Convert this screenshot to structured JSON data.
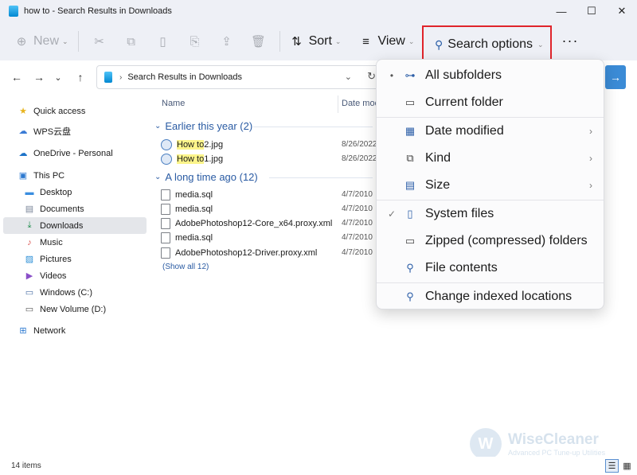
{
  "window": {
    "title": "how to - Search Results in Downloads",
    "controls": [
      "—",
      "☐",
      "✕"
    ]
  },
  "toolbar": {
    "new_label": "New",
    "sort_label": "Sort",
    "view_label": "View",
    "search_options_label": "Search options",
    "more_label": "···"
  },
  "address": {
    "crumb": "Search Results in Downloads"
  },
  "sidebar": {
    "items": [
      {
        "label": "Quick access",
        "icon": "star-icon"
      },
      {
        "label": "WPS云盘",
        "icon": "cloud-icon"
      },
      {
        "label": "OneDrive - Personal",
        "icon": "onedrive-icon"
      },
      {
        "label": "This PC",
        "icon": "computer-icon"
      },
      {
        "label": "Desktop",
        "icon": "desktop-icon"
      },
      {
        "label": "Documents",
        "icon": "documents-icon"
      },
      {
        "label": "Downloads",
        "icon": "download-icon"
      },
      {
        "label": "Music",
        "icon": "music-icon"
      },
      {
        "label": "Pictures",
        "icon": "pictures-icon"
      },
      {
        "label": "Videos",
        "icon": "videos-icon"
      },
      {
        "label": "Windows (C:)",
        "icon": "drive-icon"
      },
      {
        "label": "New Volume (D:)",
        "icon": "drive-icon"
      },
      {
        "label": "Network",
        "icon": "network-icon"
      }
    ]
  },
  "columns": {
    "name": "Name",
    "date": "Date mod"
  },
  "groups": [
    {
      "header": "Earlier this year (2)",
      "files": [
        {
          "hl": "How to",
          "rest": " 2.jpg",
          "date": "8/26/2022"
        },
        {
          "hl": "How to",
          "rest": " 1.jpg",
          "date": "8/26/2022"
        }
      ]
    },
    {
      "header": "A long time ago (12)",
      "files": [
        {
          "name": "media.sql",
          "date": "4/7/2010"
        },
        {
          "name": "media.sql",
          "date": "4/7/2010"
        },
        {
          "name": "AdobePhotoshop12-Core_x64.proxy.xml",
          "date": "4/7/2010"
        },
        {
          "name": "media.sql",
          "date": "4/7/2010"
        },
        {
          "name": "AdobePhotoshop12-Driver.proxy.xml",
          "date": "4/7/2010"
        }
      ]
    }
  ],
  "show_all": "(Show all 12)",
  "status": {
    "count": "14 items"
  },
  "menu": {
    "items": [
      {
        "label": "All subfolders",
        "mark": "•",
        "icon": "subfolders-icon"
      },
      {
        "label": "Current folder",
        "mark": "",
        "icon": "folder-icon"
      },
      {
        "label": "Date modified",
        "mark": "",
        "icon": "calendar-icon",
        "submenu": "›"
      },
      {
        "label": "Kind",
        "mark": "",
        "icon": "kind-icon",
        "submenu": "›"
      },
      {
        "label": "Size",
        "mark": "",
        "icon": "size-icon",
        "submenu": "›"
      },
      {
        "label": "System files",
        "mark": "✓",
        "icon": "system-file-icon"
      },
      {
        "label": "Zipped (compressed) folders",
        "mark": "",
        "icon": "zip-folder-icon"
      },
      {
        "label": "File contents",
        "mark": "",
        "icon": "file-search-icon"
      },
      {
        "label": "Change indexed locations",
        "mark": "",
        "icon": "index-icon"
      }
    ]
  },
  "watermark": {
    "letter": "W",
    "name": "WiseCleaner",
    "tagline": "Advanced PC Tune-up Utilities"
  },
  "colors": {
    "accent": "#2a5ba3",
    "highlight": "#fcf48a",
    "focus_border": "#e0242b"
  }
}
